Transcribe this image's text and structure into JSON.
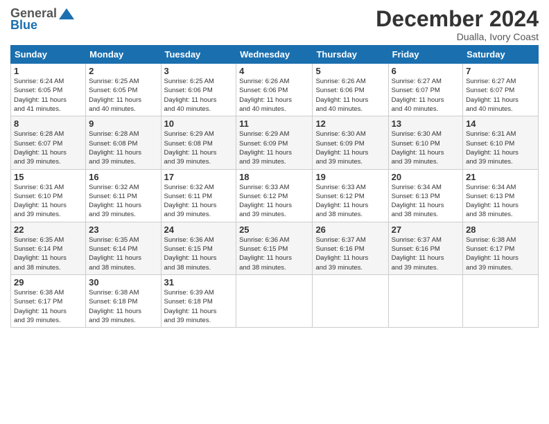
{
  "logo": {
    "line1": "General",
    "line2": "Blue"
  },
  "title": "December 2024",
  "location": "Dualla, Ivory Coast",
  "days_header": [
    "Sunday",
    "Monday",
    "Tuesday",
    "Wednesday",
    "Thursday",
    "Friday",
    "Saturday"
  ],
  "weeks": [
    [
      {
        "day": "1",
        "info": "Sunrise: 6:24 AM\nSunset: 6:05 PM\nDaylight: 11 hours\nand 41 minutes."
      },
      {
        "day": "2",
        "info": "Sunrise: 6:25 AM\nSunset: 6:05 PM\nDaylight: 11 hours\nand 40 minutes."
      },
      {
        "day": "3",
        "info": "Sunrise: 6:25 AM\nSunset: 6:06 PM\nDaylight: 11 hours\nand 40 minutes."
      },
      {
        "day": "4",
        "info": "Sunrise: 6:26 AM\nSunset: 6:06 PM\nDaylight: 11 hours\nand 40 minutes."
      },
      {
        "day": "5",
        "info": "Sunrise: 6:26 AM\nSunset: 6:06 PM\nDaylight: 11 hours\nand 40 minutes."
      },
      {
        "day": "6",
        "info": "Sunrise: 6:27 AM\nSunset: 6:07 PM\nDaylight: 11 hours\nand 40 minutes."
      },
      {
        "day": "7",
        "info": "Sunrise: 6:27 AM\nSunset: 6:07 PM\nDaylight: 11 hours\nand 40 minutes."
      }
    ],
    [
      {
        "day": "8",
        "info": "Sunrise: 6:28 AM\nSunset: 6:07 PM\nDaylight: 11 hours\nand 39 minutes."
      },
      {
        "day": "9",
        "info": "Sunrise: 6:28 AM\nSunset: 6:08 PM\nDaylight: 11 hours\nand 39 minutes."
      },
      {
        "day": "10",
        "info": "Sunrise: 6:29 AM\nSunset: 6:08 PM\nDaylight: 11 hours\nand 39 minutes."
      },
      {
        "day": "11",
        "info": "Sunrise: 6:29 AM\nSunset: 6:09 PM\nDaylight: 11 hours\nand 39 minutes."
      },
      {
        "day": "12",
        "info": "Sunrise: 6:30 AM\nSunset: 6:09 PM\nDaylight: 11 hours\nand 39 minutes."
      },
      {
        "day": "13",
        "info": "Sunrise: 6:30 AM\nSunset: 6:10 PM\nDaylight: 11 hours\nand 39 minutes."
      },
      {
        "day": "14",
        "info": "Sunrise: 6:31 AM\nSunset: 6:10 PM\nDaylight: 11 hours\nand 39 minutes."
      }
    ],
    [
      {
        "day": "15",
        "info": "Sunrise: 6:31 AM\nSunset: 6:10 PM\nDaylight: 11 hours\nand 39 minutes."
      },
      {
        "day": "16",
        "info": "Sunrise: 6:32 AM\nSunset: 6:11 PM\nDaylight: 11 hours\nand 39 minutes."
      },
      {
        "day": "17",
        "info": "Sunrise: 6:32 AM\nSunset: 6:11 PM\nDaylight: 11 hours\nand 39 minutes."
      },
      {
        "day": "18",
        "info": "Sunrise: 6:33 AM\nSunset: 6:12 PM\nDaylight: 11 hours\nand 39 minutes."
      },
      {
        "day": "19",
        "info": "Sunrise: 6:33 AM\nSunset: 6:12 PM\nDaylight: 11 hours\nand 38 minutes."
      },
      {
        "day": "20",
        "info": "Sunrise: 6:34 AM\nSunset: 6:13 PM\nDaylight: 11 hours\nand 38 minutes."
      },
      {
        "day": "21",
        "info": "Sunrise: 6:34 AM\nSunset: 6:13 PM\nDaylight: 11 hours\nand 38 minutes."
      }
    ],
    [
      {
        "day": "22",
        "info": "Sunrise: 6:35 AM\nSunset: 6:14 PM\nDaylight: 11 hours\nand 38 minutes."
      },
      {
        "day": "23",
        "info": "Sunrise: 6:35 AM\nSunset: 6:14 PM\nDaylight: 11 hours\nand 38 minutes."
      },
      {
        "day": "24",
        "info": "Sunrise: 6:36 AM\nSunset: 6:15 PM\nDaylight: 11 hours\nand 38 minutes."
      },
      {
        "day": "25",
        "info": "Sunrise: 6:36 AM\nSunset: 6:15 PM\nDaylight: 11 hours\nand 38 minutes."
      },
      {
        "day": "26",
        "info": "Sunrise: 6:37 AM\nSunset: 6:16 PM\nDaylight: 11 hours\nand 39 minutes."
      },
      {
        "day": "27",
        "info": "Sunrise: 6:37 AM\nSunset: 6:16 PM\nDaylight: 11 hours\nand 39 minutes."
      },
      {
        "day": "28",
        "info": "Sunrise: 6:38 AM\nSunset: 6:17 PM\nDaylight: 11 hours\nand 39 minutes."
      }
    ],
    [
      {
        "day": "29",
        "info": "Sunrise: 6:38 AM\nSunset: 6:17 PM\nDaylight: 11 hours\nand 39 minutes."
      },
      {
        "day": "30",
        "info": "Sunrise: 6:38 AM\nSunset: 6:18 PM\nDaylight: 11 hours\nand 39 minutes."
      },
      {
        "day": "31",
        "info": "Sunrise: 6:39 AM\nSunset: 6:18 PM\nDaylight: 11 hours\nand 39 minutes."
      },
      {
        "day": "",
        "info": ""
      },
      {
        "day": "",
        "info": ""
      },
      {
        "day": "",
        "info": ""
      },
      {
        "day": "",
        "info": ""
      }
    ]
  ]
}
